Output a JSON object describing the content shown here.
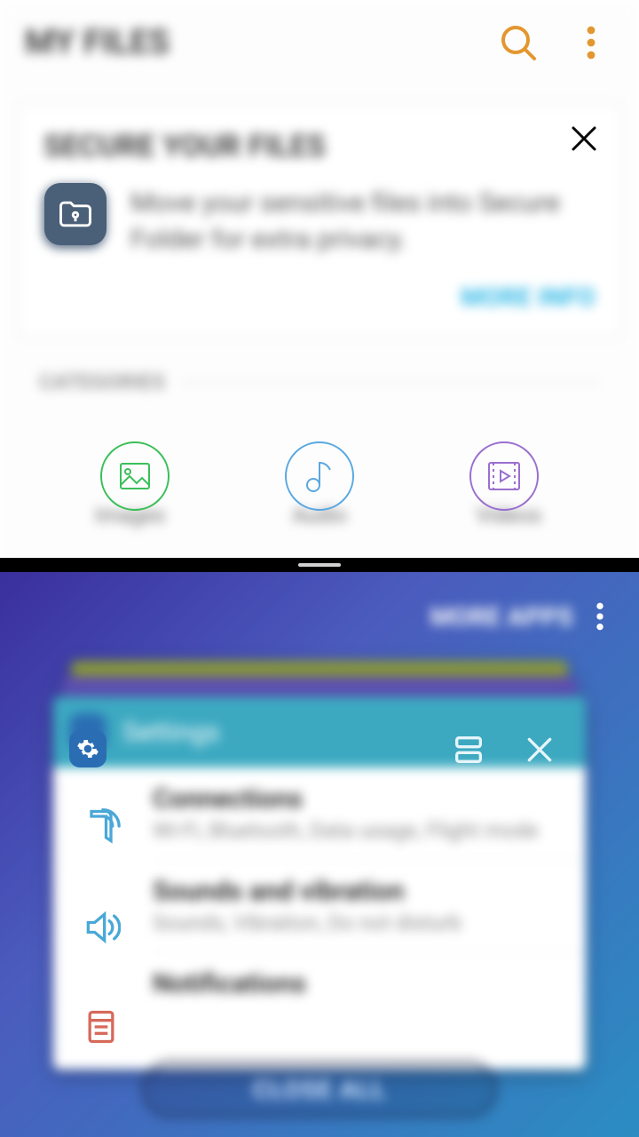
{
  "myfiles": {
    "title": "MY FILES",
    "secure_card": {
      "title": "SECURE YOUR FILES",
      "desc": "Move your sensitive files into Secure Folder for extra privacy.",
      "action": "MORE INFO"
    },
    "section_label": "CATEGORIES",
    "categories": {
      "images": "Images",
      "audio": "Audio",
      "videos": "Videos"
    }
  },
  "recents": {
    "more_apps": "MORE APPS",
    "close_all": "CLOSE ALL",
    "settings_card": {
      "title": "Settings",
      "rows": {
        "connections": {
          "title": "Connections",
          "sub": "Wi-Fi, Bluetooth, Data usage, Flight mode"
        },
        "sounds": {
          "title": "Sounds and vibration",
          "sub": "Sounds, Vibration, Do not disturb"
        },
        "notifications": {
          "title": "Notifications"
        }
      }
    }
  },
  "colors": {
    "accent_orange": "#e39730",
    "accent_teal": "#29b6e6",
    "cat_green": "#3bbf5a",
    "cat_blue": "#5aa8e0",
    "cat_purple": "#9a6fd0",
    "settings_bar": "#3ca9c1"
  }
}
